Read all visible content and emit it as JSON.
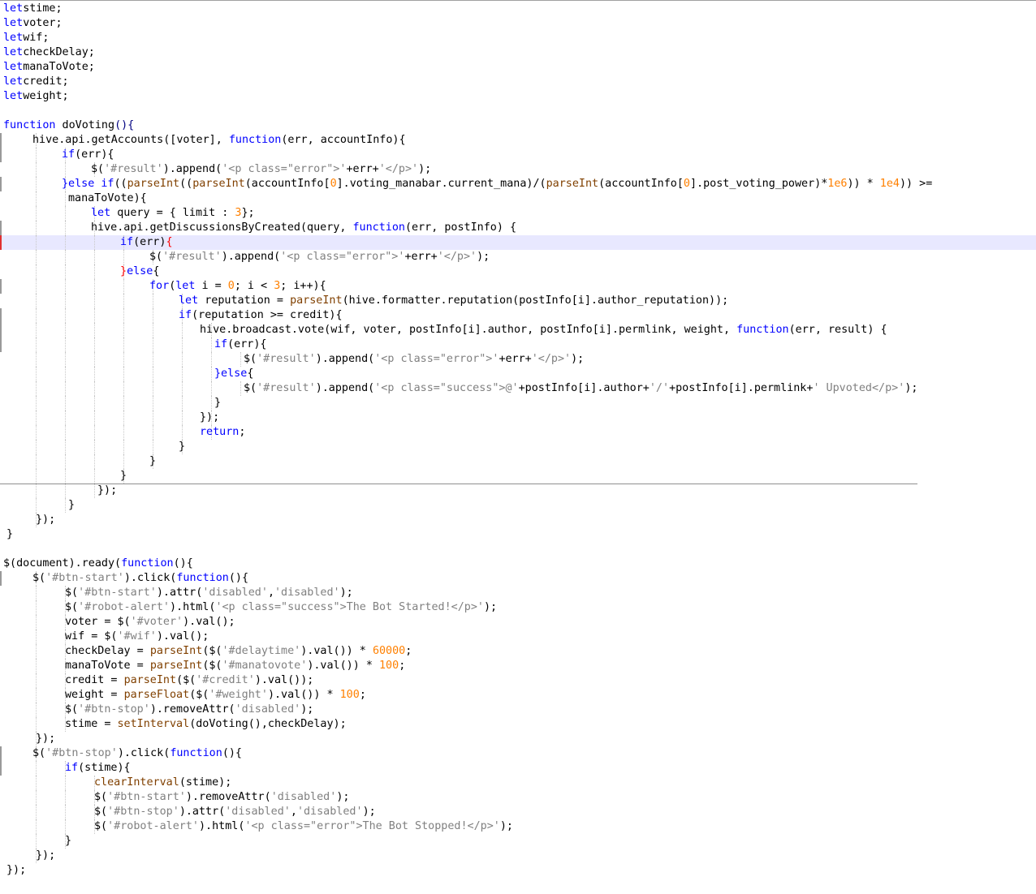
{
  "editor": {
    "language": "javascript",
    "current_line_index": 16,
    "lines": [
      {
        "indent": 0,
        "fold": "",
        "tokens": [
          [
            "kw",
            "let"
          ],
          [
            "",
            "stime;"
          ]
        ]
      },
      {
        "indent": 0,
        "fold": "",
        "tokens": [
          [
            "kw",
            "let"
          ],
          [
            "",
            "voter;"
          ]
        ]
      },
      {
        "indent": 0,
        "fold": "",
        "tokens": [
          [
            "kw",
            "let"
          ],
          [
            "",
            "wif;"
          ]
        ]
      },
      {
        "indent": 0,
        "fold": "",
        "tokens": [
          [
            "kw",
            "let"
          ],
          [
            "",
            "checkDelay;"
          ]
        ]
      },
      {
        "indent": 0,
        "fold": "",
        "tokens": [
          [
            "kw",
            "let"
          ],
          [
            "",
            "manaToVote;"
          ]
        ]
      },
      {
        "indent": 0,
        "fold": "",
        "tokens": [
          [
            "kw",
            "let"
          ],
          [
            "",
            "credit;"
          ]
        ]
      },
      {
        "indent": 0,
        "fold": "",
        "tokens": [
          [
            "kw",
            "let"
          ],
          [
            "",
            "weight;"
          ]
        ]
      },
      {
        "indent": 0,
        "fold": "",
        "tokens": []
      },
      {
        "indent": 0,
        "fold": "",
        "tokens": [
          [
            "kw",
            "function"
          ],
          [
            "",
            " doVoting"
          ],
          [
            "op",
            "(){"
          ]
        ]
      },
      {
        "indent": 1,
        "fold": "bar",
        "tokens": [
          [
            "",
            "hive.api.getAccounts([voter], "
          ],
          [
            "kw",
            "function"
          ],
          [
            "",
            "(err, accountInfo){"
          ]
        ]
      },
      {
        "indent": 2,
        "fold": "bar",
        "tokens": [
          [
            "kw",
            "if"
          ],
          [
            "",
            "(err){"
          ]
        ]
      },
      {
        "indent": 3,
        "fold": "",
        "tokens": [
          [
            "",
            "$("
          ],
          [
            "str",
            "'#result'"
          ],
          [
            "",
            ").append("
          ],
          [
            "str",
            "'<p class=\"error\">'"
          ],
          [
            "",
            "+err+"
          ],
          [
            "str",
            "'</p>'"
          ],
          [
            "",
            ");"
          ]
        ]
      },
      {
        "indent": 2,
        "fold": "bar",
        "tokens": [
          [
            "kw",
            "}else if"
          ],
          [
            "",
            "(("
          ],
          [
            "fn",
            "parseInt"
          ],
          [
            "",
            "(("
          ],
          [
            "fn",
            "parseInt"
          ],
          [
            "",
            "(accountInfo["
          ],
          [
            "num",
            "0"
          ],
          [
            "",
            "].voting_manabar.current_mana)/("
          ],
          [
            "fn",
            "parseInt"
          ],
          [
            "",
            "(accountInfo["
          ],
          [
            "num",
            "0"
          ],
          [
            "",
            "].post_voting_power)*"
          ],
          [
            "num",
            "1e6"
          ],
          [
            "",
            ")) * "
          ],
          [
            "num",
            "1e4"
          ],
          [
            "",
            ")) >="
          ]
        ]
      },
      {
        "indent": 2,
        "fold": "",
        "tokens": [
          [
            "",
            "manaToVote){"
          ]
        ],
        "offset": 8
      },
      {
        "indent": 3,
        "fold": "",
        "tokens": [
          [
            "kw",
            "let"
          ],
          [
            "",
            " query = { limit : "
          ],
          [
            "num",
            "3"
          ],
          [
            "",
            "};"
          ]
        ]
      },
      {
        "indent": 3,
        "fold": "bar",
        "tokens": [
          [
            "",
            "hive.api.getDiscussionsByCreated(query, "
          ],
          [
            "kw",
            "function"
          ],
          [
            "",
            "(err, postInfo) {"
          ]
        ]
      },
      {
        "indent": 4,
        "fold": "mark",
        "tokens": [
          [
            "kw",
            "if"
          ],
          [
            "",
            "(err)"
          ],
          [
            "red",
            "{"
          ]
        ]
      },
      {
        "indent": 5,
        "fold": "",
        "tokens": [
          [
            "",
            "$("
          ],
          [
            "str",
            "'#result'"
          ],
          [
            "",
            ").append("
          ],
          [
            "str",
            "'<p class=\"error\">'"
          ],
          [
            "",
            "+err+"
          ],
          [
            "str",
            "'</p>'"
          ],
          [
            "",
            ");"
          ]
        ]
      },
      {
        "indent": 4,
        "fold": "",
        "tokens": [
          [
            "red",
            "}"
          ],
          [
            "kw",
            "else"
          ],
          [
            "",
            "{"
          ]
        ]
      },
      {
        "indent": 5,
        "fold": "bar",
        "tokens": [
          [
            "kw",
            "for"
          ],
          [
            "",
            "("
          ],
          [
            "kw",
            "let"
          ],
          [
            "",
            " i = "
          ],
          [
            "num",
            "0"
          ],
          [
            "",
            "; i < "
          ],
          [
            "num",
            "3"
          ],
          [
            "",
            "; i++){"
          ]
        ]
      },
      {
        "indent": 6,
        "fold": "",
        "tokens": [
          [
            "kw",
            "let"
          ],
          [
            "",
            " reputation = "
          ],
          [
            "fn",
            "parseInt"
          ],
          [
            "",
            "(hive.formatter.reputation(postInfo[i].author_reputation));"
          ]
        ]
      },
      {
        "indent": 6,
        "fold": "bar",
        "tokens": [
          [
            "kw",
            "if"
          ],
          [
            "",
            "(reputation >= credit){"
          ]
        ]
      },
      {
        "indent": 7,
        "fold": "bar",
        "tokens": [
          [
            "",
            "hive.broadcast.vote(wif, voter, postInfo[i].author, postInfo[i].permlink, weight, "
          ],
          [
            "kw",
            "function"
          ],
          [
            "",
            "(err, result) {"
          ]
        ],
        "offset": -10
      },
      {
        "indent": 7,
        "fold": "bar",
        "tokens": [
          [
            "kw",
            "if"
          ],
          [
            "",
            "(err){"
          ]
        ],
        "offset": 8
      },
      {
        "indent": 8,
        "fold": "",
        "tokens": [
          [
            "",
            "$("
          ],
          [
            "str",
            "'#result'"
          ],
          [
            "",
            ").append("
          ],
          [
            "str",
            "'<p class=\"error\">'"
          ],
          [
            "",
            "+err+"
          ],
          [
            "str",
            "'</p>'"
          ],
          [
            "",
            ");"
          ]
        ],
        "offset": 8
      },
      {
        "indent": 7,
        "fold": "",
        "tokens": [
          [
            "kw",
            "}else"
          ],
          [
            "",
            "{"
          ]
        ],
        "offset": 8
      },
      {
        "indent": 8,
        "fold": "",
        "tokens": [
          [
            "",
            "$("
          ],
          [
            "str",
            "'#result'"
          ],
          [
            "",
            ").append("
          ],
          [
            "str",
            "'<p class=\"success\">@'"
          ],
          [
            "",
            "+postInfo[i].author+"
          ],
          [
            "str",
            "'/'"
          ],
          [
            "",
            "+postInfo[i].permlink+"
          ],
          [
            "str",
            "' Upvoted</p>'"
          ],
          [
            "",
            ");"
          ]
        ],
        "offset": 8
      },
      {
        "indent": 7,
        "fold": "",
        "tokens": [
          [
            "",
            "}"
          ]
        ],
        "offset": 8
      },
      {
        "indent": 7,
        "fold": "",
        "tokens": [
          [
            "",
            "});"
          ]
        ],
        "offset": -10
      },
      {
        "indent": 7,
        "fold": "",
        "tokens": [
          [
            "kw",
            "return"
          ],
          [
            "",
            ";"
          ]
        ],
        "offset": -10
      },
      {
        "indent": 6,
        "fold": "",
        "tokens": [
          [
            "",
            "}"
          ]
        ]
      },
      {
        "indent": 5,
        "fold": "",
        "tokens": [
          [
            "",
            "}"
          ]
        ]
      },
      {
        "indent": 4,
        "fold": "",
        "tokens": [
          [
            "",
            "}"
          ]
        ]
      },
      {
        "indent": 3,
        "fold": "",
        "tokens": [
          [
            "",
            "});"
          ]
        ],
        "offset": 8
      },
      {
        "indent": 2,
        "fold": "",
        "tokens": [
          [
            "",
            "}"
          ]
        ],
        "offset": 8
      },
      {
        "indent": 1,
        "fold": "",
        "tokens": [
          [
            "",
            "});"
          ]
        ],
        "offset": 4
      },
      {
        "indent": 0,
        "fold": "",
        "tokens": [
          [
            "",
            "}"
          ]
        ],
        "offset": 4
      },
      {
        "indent": 0,
        "fold": "",
        "tokens": []
      },
      {
        "indent": 0,
        "fold": "",
        "tokens": [
          [
            "",
            "$(document).ready("
          ],
          [
            "kw",
            "function"
          ],
          [
            "",
            "(){"
          ]
        ]
      },
      {
        "indent": 1,
        "fold": "bar",
        "tokens": [
          [
            "",
            "$("
          ],
          [
            "str",
            "'#btn-start'"
          ],
          [
            "",
            ").click("
          ],
          [
            "kw",
            "function"
          ],
          [
            "",
            "(){"
          ]
        ]
      },
      {
        "indent": 2,
        "fold": "",
        "tokens": [
          [
            "",
            "$("
          ],
          [
            "str",
            "'#btn-start'"
          ],
          [
            "",
            ").attr("
          ],
          [
            "str",
            "'disabled'"
          ],
          [
            "",
            ","
          ],
          [
            "str",
            "'disabled'"
          ],
          [
            "",
            ");"
          ]
        ],
        "offset": 4
      },
      {
        "indent": 2,
        "fold": "",
        "tokens": [
          [
            "",
            "$("
          ],
          [
            "str",
            "'#robot-alert'"
          ],
          [
            "",
            ").html("
          ],
          [
            "str",
            "'<p class=\"success\">The Bot Started!</p>'"
          ],
          [
            "",
            ");"
          ]
        ],
        "offset": 4
      },
      {
        "indent": 2,
        "fold": "",
        "tokens": [
          [
            "",
            "voter = $("
          ],
          [
            "str",
            "'#voter'"
          ],
          [
            "",
            ").val();"
          ]
        ],
        "offset": 4
      },
      {
        "indent": 2,
        "fold": "",
        "tokens": [
          [
            "",
            "wif = $("
          ],
          [
            "str",
            "'#wif'"
          ],
          [
            "",
            ").val();"
          ]
        ],
        "offset": 4
      },
      {
        "indent": 2,
        "fold": "",
        "tokens": [
          [
            "",
            "checkDelay = "
          ],
          [
            "fn",
            "parseInt"
          ],
          [
            "",
            "($("
          ],
          [
            "str",
            "'#delaytime'"
          ],
          [
            "",
            ").val()) * "
          ],
          [
            "num",
            "60000"
          ],
          [
            "",
            ";"
          ]
        ],
        "offset": 4
      },
      {
        "indent": 2,
        "fold": "",
        "tokens": [
          [
            "",
            "manaToVote = "
          ],
          [
            "fn",
            "parseInt"
          ],
          [
            "",
            "($("
          ],
          [
            "str",
            "'#manatovote'"
          ],
          [
            "",
            ").val()) * "
          ],
          [
            "num",
            "100"
          ],
          [
            "",
            ";"
          ]
        ],
        "offset": 4
      },
      {
        "indent": 2,
        "fold": "",
        "tokens": [
          [
            "",
            "credit = "
          ],
          [
            "fn",
            "parseInt"
          ],
          [
            "",
            "($("
          ],
          [
            "str",
            "'#credit'"
          ],
          [
            "",
            ").val());"
          ]
        ],
        "offset": 4
      },
      {
        "indent": 2,
        "fold": "",
        "tokens": [
          [
            "",
            "weight = "
          ],
          [
            "fn",
            "parseFloat"
          ],
          [
            "",
            "($("
          ],
          [
            "str",
            "'#weight'"
          ],
          [
            "",
            ").val()) * "
          ],
          [
            "num",
            "100"
          ],
          [
            "",
            ";"
          ]
        ],
        "offset": 4
      },
      {
        "indent": 2,
        "fold": "",
        "tokens": [
          [
            "",
            "$("
          ],
          [
            "str",
            "'#btn-stop'"
          ],
          [
            "",
            ").removeAttr("
          ],
          [
            "str",
            "'disabled'"
          ],
          [
            "",
            ");"
          ]
        ],
        "offset": 4
      },
      {
        "indent": 2,
        "fold": "",
        "tokens": [
          [
            "",
            "stime = "
          ],
          [
            "fn",
            "setInterval"
          ],
          [
            "",
            "(doVoting(),checkDelay);"
          ]
        ],
        "offset": 4
      },
      {
        "indent": 1,
        "fold": "",
        "tokens": [
          [
            "",
            "});"
          ]
        ],
        "offset": 4
      },
      {
        "indent": 1,
        "fold": "bar",
        "tokens": [
          [
            "",
            "$("
          ],
          [
            "str",
            "'#btn-stop'"
          ],
          [
            "",
            ").click("
          ],
          [
            "kw",
            "function"
          ],
          [
            "",
            "(){"
          ]
        ]
      },
      {
        "indent": 2,
        "fold": "bar",
        "tokens": [
          [
            "kw",
            "if"
          ],
          [
            "",
            "(stime){"
          ]
        ],
        "offset": 4
      },
      {
        "indent": 3,
        "fold": "",
        "tokens": [
          [
            "fn",
            "clearInterval"
          ],
          [
            "",
            "(stime);"
          ]
        ],
        "offset": 4
      },
      {
        "indent": 3,
        "fold": "",
        "tokens": [
          [
            "",
            "$("
          ],
          [
            "str",
            "'#btn-start'"
          ],
          [
            "",
            ").removeAttr("
          ],
          [
            "str",
            "'disabled'"
          ],
          [
            "",
            ");"
          ]
        ],
        "offset": 4
      },
      {
        "indent": 3,
        "fold": "",
        "tokens": [
          [
            "",
            "$("
          ],
          [
            "str",
            "'#btn-stop'"
          ],
          [
            "",
            ").attr("
          ],
          [
            "str",
            "'disabled'"
          ],
          [
            "",
            ","
          ],
          [
            "str",
            "'disabled'"
          ],
          [
            "",
            ");"
          ]
        ],
        "offset": 4
      },
      {
        "indent": 3,
        "fold": "",
        "tokens": [
          [
            "",
            "$("
          ],
          [
            "str",
            "'#robot-alert'"
          ],
          [
            "",
            ").html("
          ],
          [
            "str",
            "'<p class=\"error\">The Bot Stopped!</p>'"
          ],
          [
            "",
            ");"
          ]
        ],
        "offset": 4
      },
      {
        "indent": 2,
        "fold": "",
        "tokens": [
          [
            "",
            "}"
          ]
        ],
        "offset": 4
      },
      {
        "indent": 1,
        "fold": "",
        "tokens": [
          [
            "",
            "});"
          ]
        ],
        "offset": 4
      },
      {
        "indent": 0,
        "fold": "",
        "tokens": [
          [
            "",
            "});"
          ]
        ],
        "offset": 4
      }
    ]
  }
}
